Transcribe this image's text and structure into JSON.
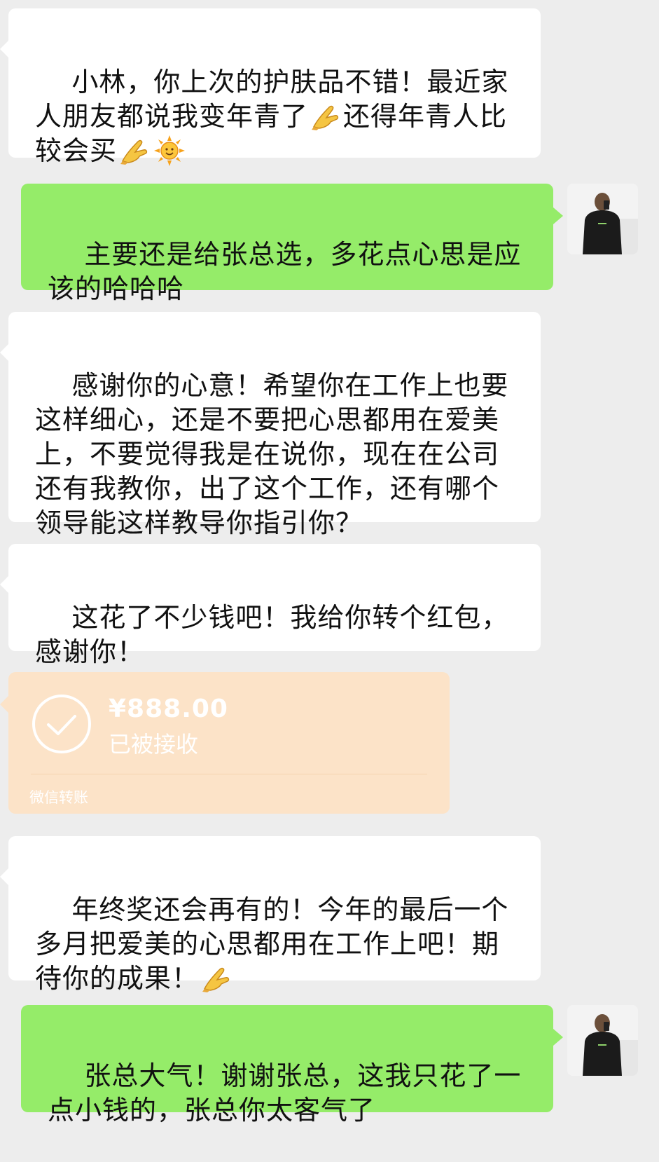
{
  "messages": [
    {
      "id": "m1",
      "side": "in",
      "text_a": "小林，你上次的护肤品不错！最近家人朋友都说我变年青了",
      "emoji_a": "ok-hand-icon",
      "text_b": "还得年青人比较会买",
      "emoji_b": "ok-hand-icon",
      "emoji_c": "sun-icon"
    },
    {
      "id": "m2",
      "side": "out",
      "text": "主要还是给张总选，多花点心思是应该的哈哈哈"
    },
    {
      "id": "m3",
      "side": "in",
      "text": "感谢你的心意！希望你在工作上也要这样细心，还是不要把心思都用在爱美上，不要觉得我是在说你，现在在公司还有我教你，出了这个工作，还有哪个领导能这样教导你指引你？"
    },
    {
      "id": "m4",
      "side": "in",
      "text": "这花了不少钱吧！我给你转个红包，感谢你！"
    },
    {
      "id": "m6",
      "side": "in",
      "text": "年终奖还会再有的！今年的最后一个多月把爱美的心思都用在工作上吧！期待你的成果！",
      "emoji": "ok-hand-icon"
    },
    {
      "id": "m7",
      "side": "out",
      "text": "张总大气！谢谢张总，这我只花了一点小钱的，张总你太客气了"
    }
  ],
  "transfer": {
    "amount": "¥888.00",
    "status": "已被接收",
    "label": "微信转账",
    "icon": "check-circle-icon",
    "background": "#fce3c8"
  },
  "colors": {
    "chat_background": "#ededed",
    "incoming_bubble": "#ffffff",
    "outgoing_bubble": "#95ec69"
  }
}
